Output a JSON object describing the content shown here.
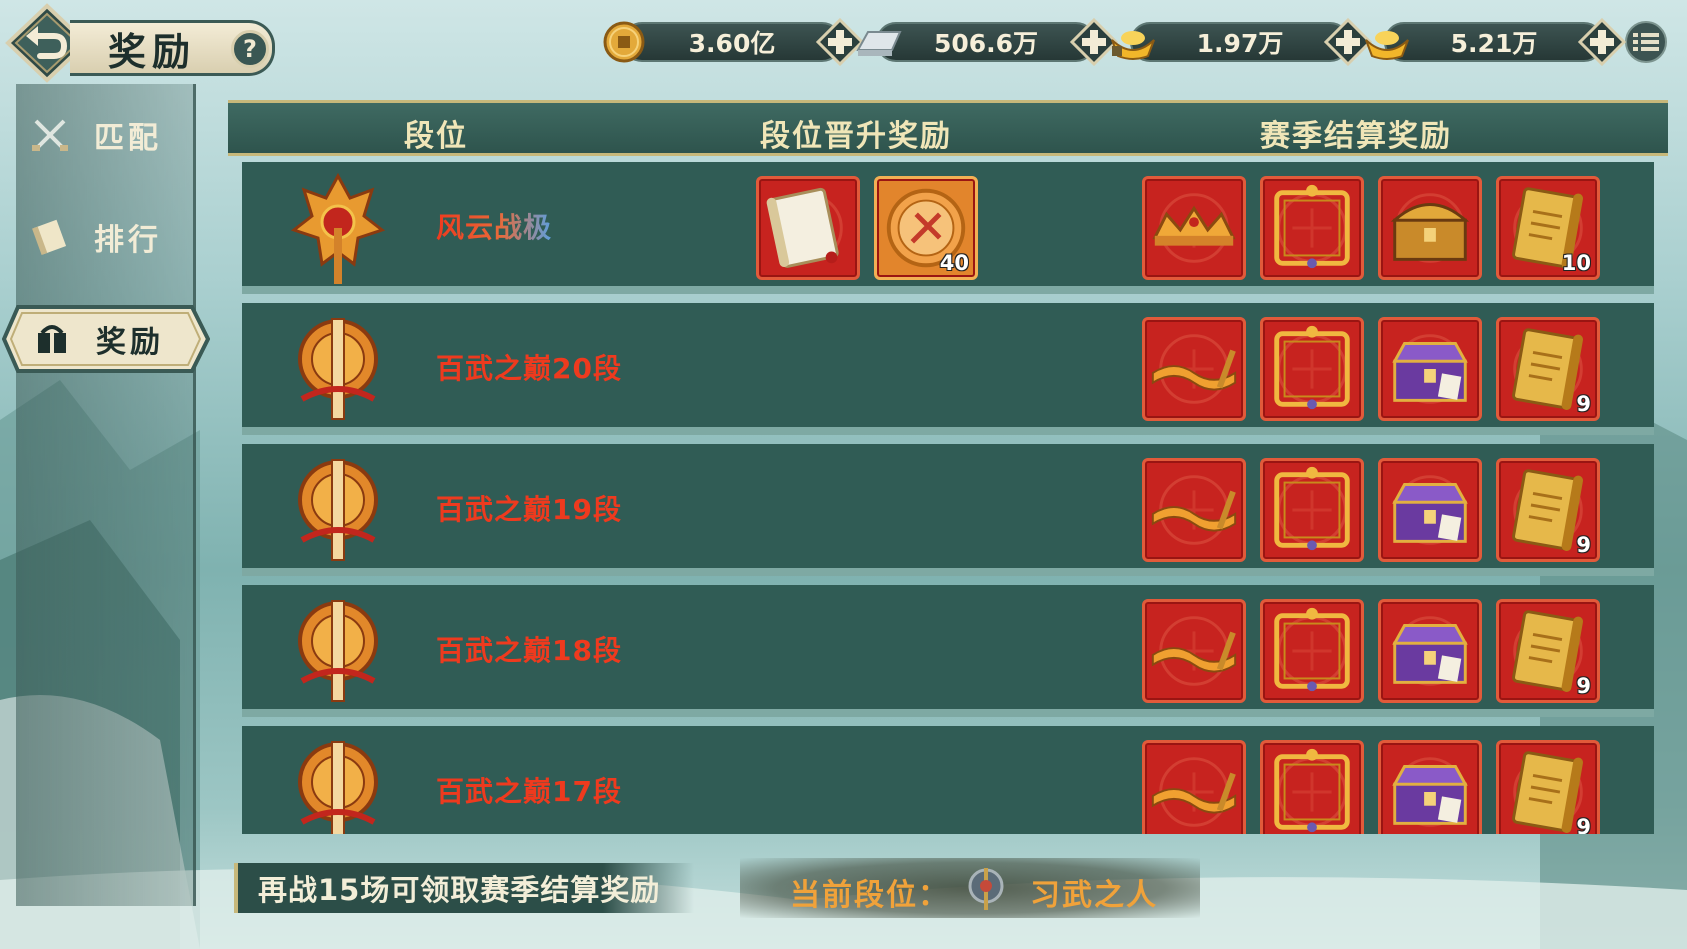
{
  "title": "奖励",
  "help_symbol": "?",
  "currencies": [
    {
      "icon": "copper-coin-icon",
      "value": "3.60亿"
    },
    {
      "icon": "silver-ingot-icon",
      "value": "506.6万"
    },
    {
      "icon": "gold-ingot-locked-icon",
      "value": "1.97万"
    },
    {
      "icon": "gold-ingot-icon",
      "value": "5.21万"
    }
  ],
  "sidebar": {
    "items": [
      {
        "icon": "crossed-swords-icon",
        "label": "匹配"
      },
      {
        "icon": "scroll-icon",
        "label": "排行"
      },
      {
        "icon": "reward-icon",
        "label": "奖励",
        "active": true
      }
    ]
  },
  "table": {
    "headers": {
      "rank": "段位",
      "promotion": "段位晋升奖励",
      "season": "赛季结算奖励"
    },
    "rows": [
      {
        "rank_name": "风云战极",
        "promotion_rewards": [
          {
            "icon": "scroll-book-icon",
            "count": ""
          },
          {
            "icon": "medal-token-icon",
            "count": "40"
          }
        ],
        "season_rewards": [
          {
            "icon": "crown-icon",
            "count": ""
          },
          {
            "icon": "ornate-frame-icon",
            "count": ""
          },
          {
            "icon": "treasure-chest-icon",
            "count": ""
          },
          {
            "icon": "golden-scroll-icon",
            "count": "10"
          }
        ]
      },
      {
        "rank_name": "百武之巅20段",
        "promotion_rewards": [],
        "season_rewards": [
          {
            "icon": "golden-banner-icon",
            "count": ""
          },
          {
            "icon": "ornate-frame-icon",
            "count": ""
          },
          {
            "icon": "purple-chest-icon",
            "count": ""
          },
          {
            "icon": "golden-scroll-icon",
            "count": "9"
          }
        ]
      },
      {
        "rank_name": "百武之巅19段",
        "promotion_rewards": [],
        "season_rewards": [
          {
            "icon": "golden-banner-icon",
            "count": ""
          },
          {
            "icon": "ornate-frame-icon",
            "count": ""
          },
          {
            "icon": "purple-chest-icon",
            "count": ""
          },
          {
            "icon": "golden-scroll-icon",
            "count": "9"
          }
        ]
      },
      {
        "rank_name": "百武之巅18段",
        "promotion_rewards": [],
        "season_rewards": [
          {
            "icon": "golden-banner-icon",
            "count": ""
          },
          {
            "icon": "ornate-frame-icon",
            "count": ""
          },
          {
            "icon": "purple-chest-icon",
            "count": ""
          },
          {
            "icon": "golden-scroll-icon",
            "count": "9"
          }
        ]
      },
      {
        "rank_name": "百武之巅17段",
        "promotion_rewards": [],
        "season_rewards": [
          {
            "icon": "golden-banner-icon",
            "count": ""
          },
          {
            "icon": "ornate-frame-icon",
            "count": ""
          },
          {
            "icon": "purple-chest-icon",
            "count": ""
          },
          {
            "icon": "golden-scroll-icon",
            "count": "9"
          }
        ]
      }
    ]
  },
  "footer": {
    "remaining_matches": "再战15场可领取赛季结算奖励",
    "current_rank_label": "当前段位：",
    "current_rank_name": "习武之人"
  },
  "colors": {
    "rank_red": "#ee3a1e",
    "tile_red": "#c7231f",
    "header_gold": "#f0e6b8",
    "current_rank_orange": "#f0a23a"
  }
}
